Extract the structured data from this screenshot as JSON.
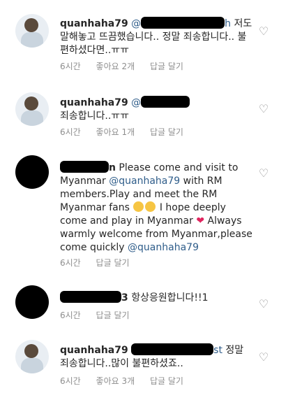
{
  "comments": [
    {
      "username": "quanhaha79",
      "mention_prefix": "@",
      "mention_suffix": "h",
      "text": "저도 말해놓고 뜨끔했습니다.. 정말 죄송합니다.. 불편하셨다면..ㅠㅠ",
      "time": "6시간",
      "likes": "좋아요 2개",
      "reply": "답글 달기"
    },
    {
      "username": "quanhaha79",
      "mention_prefix": "@",
      "text": "죄송합니다..ㅠㅠ",
      "time": "6시간",
      "likes": "좋아요 1개",
      "reply": "답글 달기"
    },
    {
      "username_suffix": "n",
      "text_part1": "Please come and visit to Myanmar",
      "mention1": "@quanhaha79",
      "text_part2": "with RM members.Play and meet the RM Myanmar fans",
      "text_part3": "I hope deeply come and play in Myanmar",
      "text_part4": "Always warmly welcome from Myanmar,please come quickly",
      "mention2": "@quanhaha79",
      "time": "6시간",
      "reply": "답글 달기"
    },
    {
      "username_suffix": "3",
      "text": "항상응원합니다!!1",
      "time": "6시간",
      "reply": "답글 달기"
    },
    {
      "username": "quanhaha79",
      "mention_suffix": "st",
      "text": "정말 죄송합니다..많이 불편하셨죠..",
      "time": "6시간",
      "likes": "좋아요 3개",
      "reply": "답글 달기"
    }
  ],
  "icons": {
    "like": "heart-outline-icon"
  }
}
